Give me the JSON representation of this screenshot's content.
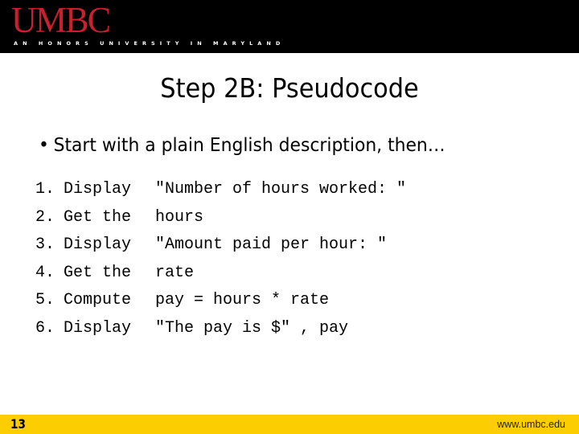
{
  "header": {
    "logo_text": "UMBC",
    "tagline": "AN HONORS UNIVERSITY IN MARYLAND",
    "background_color": "#000000",
    "logo_color": "#c8202c"
  },
  "slide": {
    "title": "Step 2B: Pseudocode",
    "bullet": "Start with a plain English description, then…",
    "steps": [
      {
        "number": "1.",
        "verb": "Display",
        "rest": "\"Number of hours worked: \""
      },
      {
        "number": "2.",
        "verb": "Get the",
        "rest": "hours"
      },
      {
        "number": "3.",
        "verb": "Display",
        "rest": "\"Amount paid per hour: \""
      },
      {
        "number": "4.",
        "verb": "Get the",
        "rest": "rate"
      },
      {
        "number": "5.",
        "verb": "Compute",
        "rest": "pay = hours * rate"
      },
      {
        "number": "6.",
        "verb": "Display",
        "rest": "\"The pay is $\" , pay"
      }
    ]
  },
  "footer": {
    "page_number": "13",
    "url": "www.umbc.edu",
    "background_color": "#fccd00"
  }
}
